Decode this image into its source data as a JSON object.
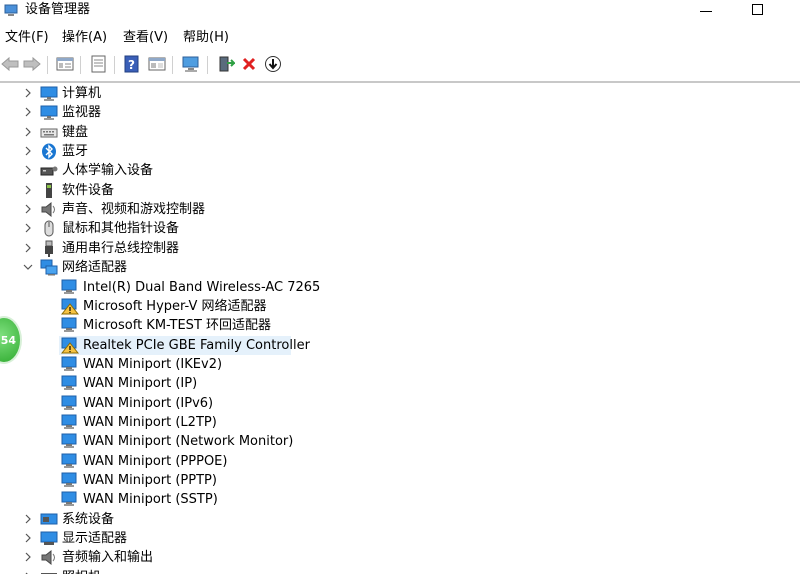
{
  "window": {
    "title": "设备管理器"
  },
  "menu": [
    "文件(F)",
    "操作(A)",
    "查看(V)",
    "帮助(H)"
  ],
  "toolbar": {
    "buttons": [
      "back-icon",
      "forward-icon",
      "properties-icon",
      "update-driver-icon",
      "help-icon",
      "view-icon",
      "monitor-icon",
      "enable-device-icon",
      "uninstall-icon",
      "download-icon"
    ]
  },
  "tree": [
    {
      "label": "计算机",
      "expanded": false,
      "icon": "computer-icon"
    },
    {
      "label": "监视器",
      "expanded": false,
      "icon": "monitor-icon"
    },
    {
      "label": "键盘",
      "expanded": false,
      "icon": "keyboard-icon"
    },
    {
      "label": "蓝牙",
      "expanded": false,
      "icon": "bluetooth-icon"
    },
    {
      "label": "人体学输入设备",
      "expanded": false,
      "icon": "hid-icon"
    },
    {
      "label": "软件设备",
      "expanded": false,
      "icon": "software-device-icon"
    },
    {
      "label": "声音、视频和游戏控制器",
      "expanded": false,
      "icon": "speaker-icon"
    },
    {
      "label": "鼠标和其他指针设备",
      "expanded": false,
      "icon": "mouse-icon"
    },
    {
      "label": "通用串行总线控制器",
      "expanded": false,
      "icon": "usb-icon"
    },
    {
      "label": "网络适配器",
      "expanded": true,
      "icon": "network-icon"
    },
    {
      "label": "Intel(R) Dual Band Wireless-AC 7265",
      "child": true,
      "icon": "network-adapter-icon"
    },
    {
      "label": "Microsoft Hyper-V 网络适配器",
      "child": true,
      "icon": "network-adapter-warning-icon",
      "warning": true
    },
    {
      "label": "Microsoft KM-TEST 环回适配器",
      "child": true,
      "icon": "network-adapter-icon"
    },
    {
      "label": "Realtek PCIe GBE Family Controller",
      "child": true,
      "icon": "network-adapter-warning-icon",
      "warning": true,
      "selected": true
    },
    {
      "label": "WAN Miniport (IKEv2)",
      "child": true,
      "icon": "network-adapter-icon"
    },
    {
      "label": "WAN Miniport (IP)",
      "child": true,
      "icon": "network-adapter-icon"
    },
    {
      "label": "WAN Miniport (IPv6)",
      "child": true,
      "icon": "network-adapter-icon"
    },
    {
      "label": "WAN Miniport (L2TP)",
      "child": true,
      "icon": "network-adapter-icon"
    },
    {
      "label": "WAN Miniport (Network Monitor)",
      "child": true,
      "icon": "network-adapter-icon"
    },
    {
      "label": "WAN Miniport (PPPOE)",
      "child": true,
      "icon": "network-adapter-icon"
    },
    {
      "label": "WAN Miniport (PPTP)",
      "child": true,
      "icon": "network-adapter-icon"
    },
    {
      "label": "WAN Miniport (SSTP)",
      "child": true,
      "icon": "network-adapter-icon"
    },
    {
      "label": "系统设备",
      "expanded": false,
      "icon": "system-device-icon"
    },
    {
      "label": "显示适配器",
      "expanded": false,
      "icon": "display-adapter-icon"
    },
    {
      "label": "音频输入和输出",
      "expanded": false,
      "icon": "audio-io-icon"
    },
    {
      "label": "照相机",
      "expanded": false,
      "icon": "camera-icon"
    }
  ],
  "side_badge": "54"
}
